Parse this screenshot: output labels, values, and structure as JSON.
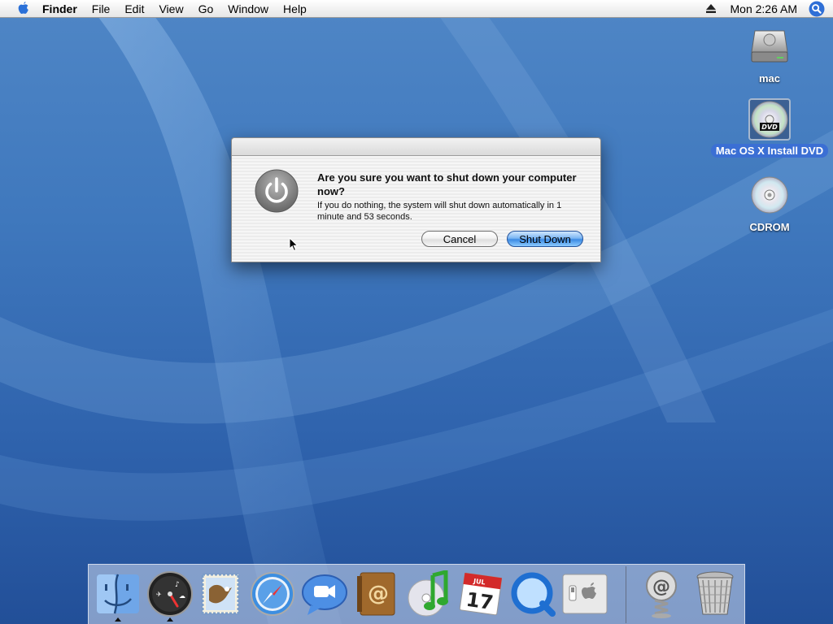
{
  "menubar": {
    "apple": "apple-logo",
    "app_name": "Finder",
    "items": [
      "File",
      "Edit",
      "View",
      "Go",
      "Window",
      "Help"
    ],
    "clock": "Mon 2:26 AM"
  },
  "desktop_icons": [
    {
      "label": "mac",
      "icon": "hard-drive-icon",
      "selected": false
    },
    {
      "label": "Mac OS X Install DVD",
      "icon": "dvd-icon",
      "selected": true
    },
    {
      "label": "CDROM",
      "icon": "cd-icon",
      "selected": false
    }
  ],
  "dialog": {
    "title": "Are you sure you want to shut down your computer now?",
    "message": "If you do nothing, the system will shut down automatically in 1 minute and 53 seconds.",
    "cancel_label": "Cancel",
    "confirm_label": "Shut Down"
  },
  "dock": {
    "apps": [
      "Finder",
      "Dashboard",
      "Mail",
      "Safari",
      "iChat",
      "Address Book",
      "iTunes",
      "iCal",
      "QuickTime Player",
      "System Preferences"
    ],
    "others": [
      "Internet Connect",
      "Trash"
    ],
    "running": [
      "Finder",
      "Dashboard"
    ],
    "ical_month": "JUL",
    "ical_day": "17"
  },
  "colors": {
    "desktop": "#3f78bd",
    "selection": "#3b6fd4",
    "default_button": "#3b8ae4"
  }
}
